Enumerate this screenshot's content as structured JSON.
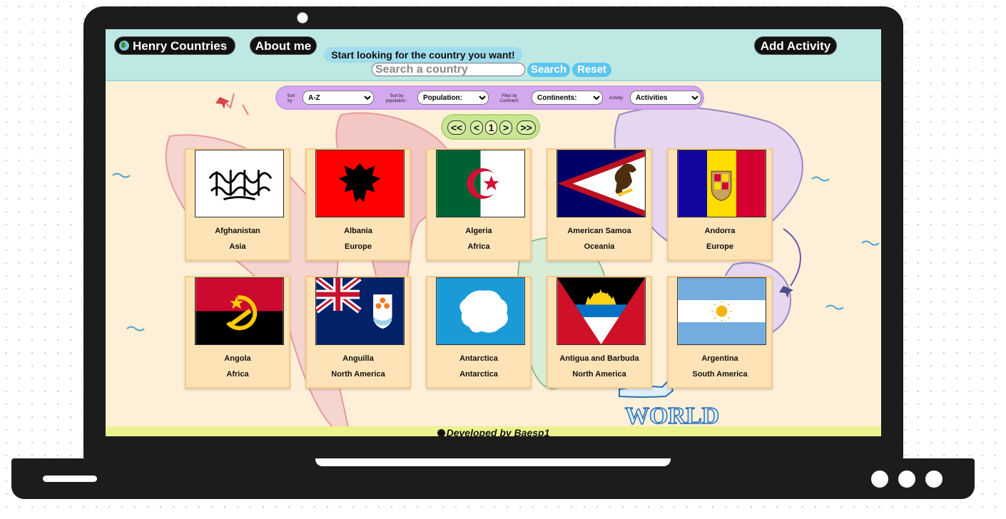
{
  "header": {
    "brand_label": "Henry Countries",
    "about_label": "About me",
    "add_activity_label": "Add Activity",
    "search_hint": "Start looking for the country you want!",
    "search_placeholder": "Search a country",
    "search_button": "Search",
    "reset_button": "Reset"
  },
  "filters": {
    "sort_label": "Sort by :",
    "sort_value": "A-Z",
    "population_label": "Sort by population :",
    "population_value": "Population:",
    "continent_label": "Filter by Continent:",
    "continent_value": "Continents:",
    "activity_label": "Activity:",
    "activity_value": "Activities"
  },
  "pagination": {
    "first": "<<",
    "prev": "<",
    "current": "1",
    "next": ">",
    "last": ">>"
  },
  "countries": [
    {
      "name": "Afghanistan",
      "continent": "Asia",
      "flag_icon": "flag-afghanistan-icon"
    },
    {
      "name": "Albania",
      "continent": "Europe",
      "flag_icon": "flag-albania-icon"
    },
    {
      "name": "Algeria",
      "continent": "Africa",
      "flag_icon": "flag-algeria-icon"
    },
    {
      "name": "American Samoa",
      "continent": "Oceania",
      "flag_icon": "flag-american-samoa-icon"
    },
    {
      "name": "Andorra",
      "continent": "Europe",
      "flag_icon": "flag-andorra-icon"
    },
    {
      "name": "Angola",
      "continent": "Africa",
      "flag_icon": "flag-angola-icon"
    },
    {
      "name": "Anguilla",
      "continent": "North America",
      "flag_icon": "flag-anguilla-icon"
    },
    {
      "name": "Antarctica",
      "continent": "Antarctica",
      "flag_icon": "flag-antarctica-icon"
    },
    {
      "name": "Antigua and Barbuda",
      "continent": "North America",
      "flag_icon": "flag-antigua-icon"
    },
    {
      "name": "Argentina",
      "continent": "South America",
      "flag_icon": "flag-argentina-icon"
    }
  ],
  "map_label": "WORLD",
  "footer": {
    "text": "Developed by Baesp1"
  },
  "colors": {
    "header_bg": "#bde8e3",
    "accent_blue": "#5cc6ee",
    "filter_purple": "#d4a8ef",
    "pagination_green": "#c8e693",
    "card_bg": "#fde3b6",
    "footer_yellow": "#ebf28e"
  }
}
